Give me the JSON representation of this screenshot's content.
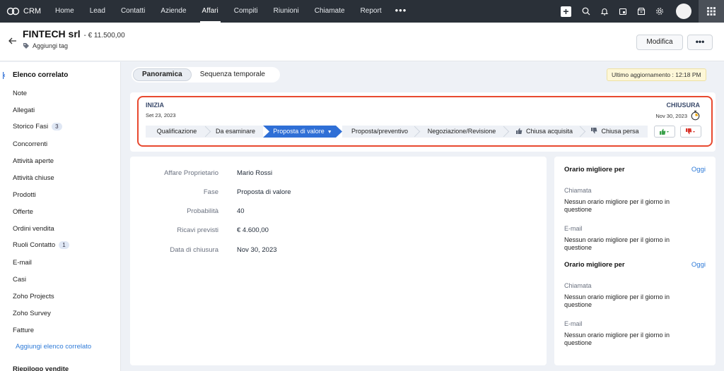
{
  "nav": {
    "brand": "CRM",
    "items": [
      "Home",
      "Lead",
      "Contatti",
      "Aziende",
      "Affari",
      "Compiti",
      "Riunioni",
      "Chiamate",
      "Report"
    ],
    "active": "Affari",
    "more": "•••"
  },
  "header": {
    "record_name": "FINTECH srl",
    "amount": "- € 11.500,00",
    "add_tag": "Aggiungi tag",
    "edit_label": "Modifica",
    "more_label": "•••"
  },
  "sidebar": {
    "title": "Elenco correlato",
    "items": [
      {
        "label": "Note"
      },
      {
        "label": "Allegati"
      },
      {
        "label": "Storico Fasi",
        "count": "3"
      },
      {
        "label": "Concorrenti"
      },
      {
        "label": "Attività aperte"
      },
      {
        "label": "Attività chiuse"
      },
      {
        "label": "Prodotti"
      },
      {
        "label": "Offerte"
      },
      {
        "label": "Ordini vendita"
      },
      {
        "label": "Ruoli Contatto",
        "count": "1"
      },
      {
        "label": "E-mail"
      },
      {
        "label": "Casi"
      },
      {
        "label": "Zoho Projects"
      },
      {
        "label": "Zoho Survey"
      },
      {
        "label": "Fatture"
      }
    ],
    "add_link": "Aggiungi elenco correlato",
    "next_section": "Riepilogo vendite"
  },
  "tabs": [
    "Panoramica",
    "Sequenza temporale"
  ],
  "last_update": "Ultimo aggiornamento : 12:18 PM",
  "stage": {
    "start_label": "INIZIA",
    "start_date": "Set 23, 2023",
    "end_label": "CHIUSURA",
    "end_date": "Nov 30, 2023",
    "steps": [
      "Qualificazione",
      "Da esaminare",
      "Proposta di valore",
      "Proposta/preventivo",
      "Negoziazione/Revisione",
      "Chiusa acquisita",
      "Chiusa persa"
    ],
    "current": "Proposta di valore"
  },
  "details": [
    {
      "label": "Affare Proprietario",
      "value": "Mario Rossi"
    },
    {
      "label": "Fase",
      "value": "Proposta di valore"
    },
    {
      "label": "Probabilità",
      "value": "40"
    },
    {
      "label": "Ricavi previsti",
      "value": "€ 4.600,00"
    },
    {
      "label": "Data di chiusura",
      "value": "Nov 30, 2023"
    }
  ],
  "best_time": [
    {
      "title": "Orario migliore per",
      "today": "Oggi",
      "call_label": "Chiamata",
      "call_msg": "Nessun orario migliore per il giorno in questione",
      "email_label": "E-mail",
      "email_msg": "Nessun orario migliore per il giorno in questione"
    },
    {
      "title": "Orario migliore per",
      "today": "Oggi",
      "call_label": "Chiamata",
      "call_msg": "Nessun orario migliore per il giorno in questione",
      "email_label": "E-mail",
      "email_msg": "Nessun orario migliore per il giorno in questione"
    }
  ],
  "colors": {
    "topbar": "#2a3038",
    "accent": "#2f6fd6",
    "highlight_border": "#e8492f",
    "won": "#3aa14b",
    "lost": "#d9342b",
    "link": "#2f7bd8"
  }
}
